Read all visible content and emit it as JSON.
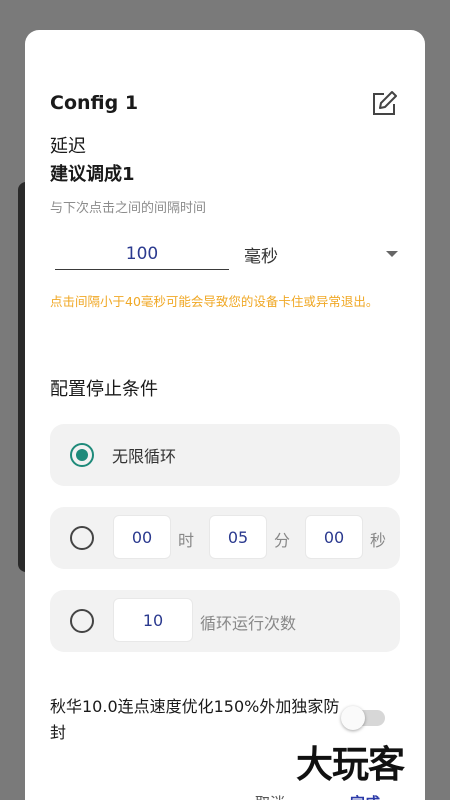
{
  "dialog": {
    "title": "Config 1",
    "delay_heading": "延迟",
    "delay_recommend": "建议调成1",
    "delay_subtitle": "与下次点击之间的间隔时间",
    "delay_value": "100",
    "delay_unit": "毫秒",
    "warning_text": "点击间隔小于40毫秒可能会导致您的设备卡住或异常退出。",
    "stop_title": "配置停止条件",
    "stop_options": {
      "infinite": {
        "label": "无限循环",
        "selected": true
      },
      "timer": {
        "hours": "00",
        "hours_unit": "时",
        "minutes": "05",
        "minutes_unit": "分",
        "seconds": "00",
        "seconds_unit": "秒",
        "selected": false
      },
      "count": {
        "value": "10",
        "label": "循环运行次数",
        "selected": false
      }
    },
    "promo_text": "秋华10.0连点速度优化150%外加独家防封",
    "promo_toggle": false,
    "cancel_label": "取消",
    "done_label": "完成"
  },
  "watermark": "大玩客",
  "colors": {
    "accent_teal": "#1e8a7a",
    "value_blue": "#2b3a8f",
    "warning_orange": "#f0a826",
    "option_bg": "#f2f2f2"
  },
  "icons": {
    "edit": "edit-icon"
  }
}
